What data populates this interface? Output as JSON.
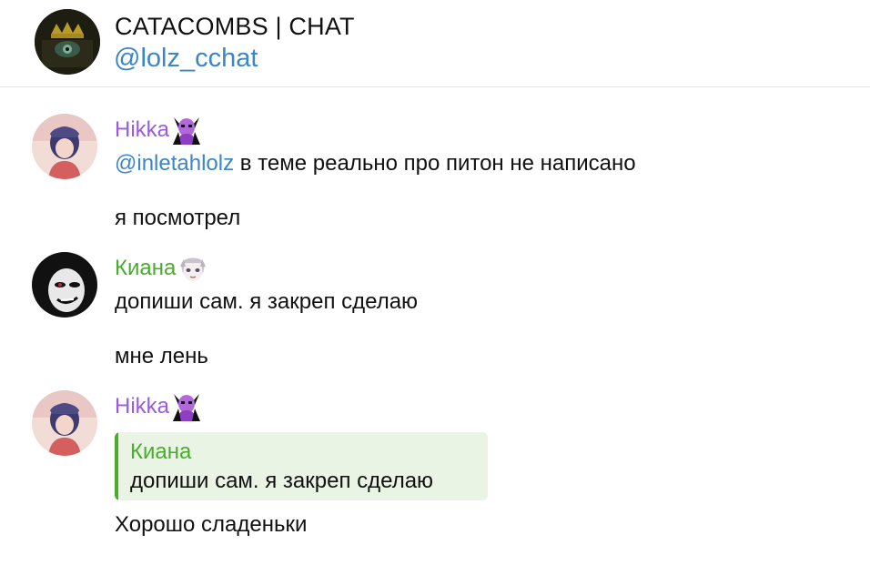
{
  "header": {
    "title": "CATACOMBS | CHAT",
    "handle": "@lolz_cchat"
  },
  "colors": {
    "accent_blue": "#3a86c8",
    "hikka_name": "#9b5be0",
    "kiana_name": "#4aab2c",
    "reply_bg": "#eaf4e5"
  },
  "messages": [
    {
      "author": "Hikka",
      "author_emoji": "purple-demon-emoji",
      "mention": "@inletahlolz",
      "line1_rest": " в теме реально про питон не написано",
      "line2": "я посмотрел"
    },
    {
      "author": "Киана",
      "author_emoji": "anime-girl-emoji",
      "line1": "допиши сам. я закреп сделаю",
      "line2": "мне лень"
    },
    {
      "author": "Hikka",
      "author_emoji": "purple-demon-emoji",
      "reply": {
        "author": "Киана",
        "text": "допиши сам. я закреп сделаю"
      },
      "text": "Хорошо сладеньки"
    }
  ]
}
